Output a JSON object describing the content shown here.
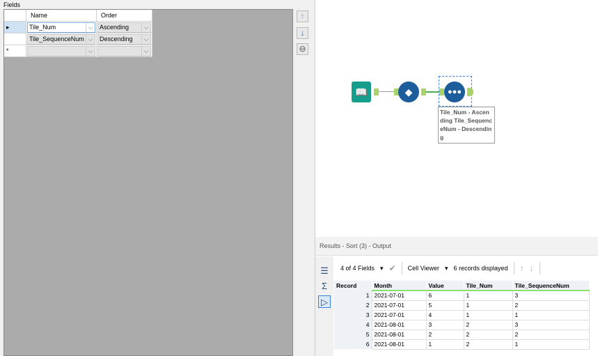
{
  "left": {
    "fields_label": "Fields",
    "columns": [
      "Name",
      "Order"
    ],
    "rows": [
      {
        "marker": "▸",
        "name": "Tile_Num",
        "order": "Ascending"
      },
      {
        "marker": "",
        "name": "Tile_SequenceNum",
        "order": "Descending"
      },
      {
        "marker": "*",
        "name": "",
        "order": ""
      }
    ]
  },
  "canvas": {
    "annotation": "Tile_Num - Ascending Tile_SequenceNum - Descending"
  },
  "results": {
    "title": "Results - Sort (3) - Output",
    "fields": "4 of 4 Fields",
    "cell_viewer": "Cell Viewer",
    "records_displayed": "6 records displayed",
    "columns": [
      "Record",
      "Month",
      "Value",
      "Tile_Num",
      "Tile_SequenceNum"
    ],
    "rows": [
      [
        "1",
        "2021-07-01",
        "6",
        "1",
        "3"
      ],
      [
        "2",
        "2021-07-01",
        "5",
        "1",
        "2"
      ],
      [
        "3",
        "2021-07-01",
        "4",
        "1",
        "1"
      ],
      [
        "4",
        "2021-08-01",
        "3",
        "2",
        "3"
      ],
      [
        "5",
        "2021-08-01",
        "2",
        "2",
        "2"
      ],
      [
        "6",
        "2021-08-01",
        "1",
        "2",
        "1"
      ]
    ]
  }
}
